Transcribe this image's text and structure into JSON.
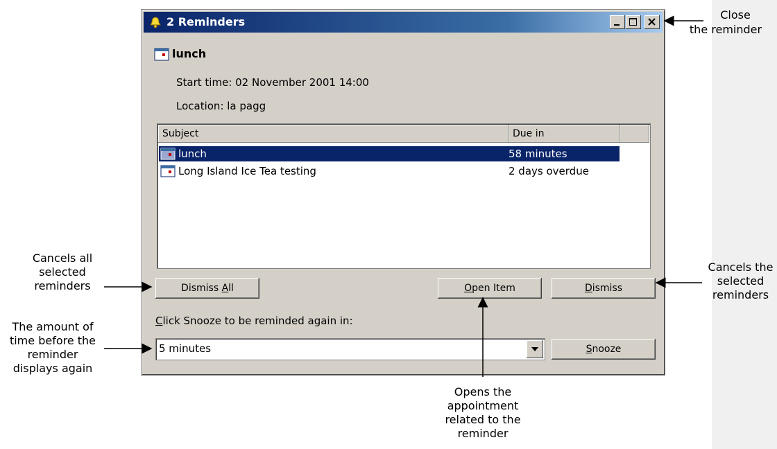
{
  "window": {
    "title": "2 Reminders",
    "item_subject": "lunch",
    "start_time": "Start time: 02 November 2001 14:00",
    "location": "Location: la pagg"
  },
  "list": {
    "columns": [
      "Subject",
      "Due in"
    ],
    "rows": [
      {
        "subject": "lunch",
        "due": "58 minutes",
        "selected": true
      },
      {
        "subject": "Long Island Ice Tea testing",
        "due": "2 days overdue",
        "selected": false
      }
    ]
  },
  "buttons": {
    "dismiss_all_prefix": "Dismiss ",
    "dismiss_all_accel": "A",
    "dismiss_all_suffix": "ll",
    "open_item_accel": "O",
    "open_item_suffix": "pen Item",
    "dismiss_accel": "D",
    "dismiss_suffix": "ismiss",
    "snooze_accel": "S",
    "snooze_suffix": "nooze"
  },
  "snooze": {
    "label_accel": "C",
    "label_suffix": "lick Snooze to be reminded again in:",
    "value": "5 minutes"
  },
  "callouts": {
    "close_line1": "Close",
    "close_line2": "the reminder",
    "dismiss_all_1": "Cancels all",
    "dismiss_all_2": "selected",
    "dismiss_all_3": "reminders",
    "dismiss_1": "Cancels the",
    "dismiss_2": "selected",
    "dismiss_3": "reminders",
    "snooze_1": "The amount of",
    "snooze_2": "time before the",
    "snooze_3": "reminder",
    "snooze_4": "displays again",
    "open_1": "Opens the",
    "open_2": "appointment",
    "open_3": "related to the",
    "open_4": "reminder"
  }
}
